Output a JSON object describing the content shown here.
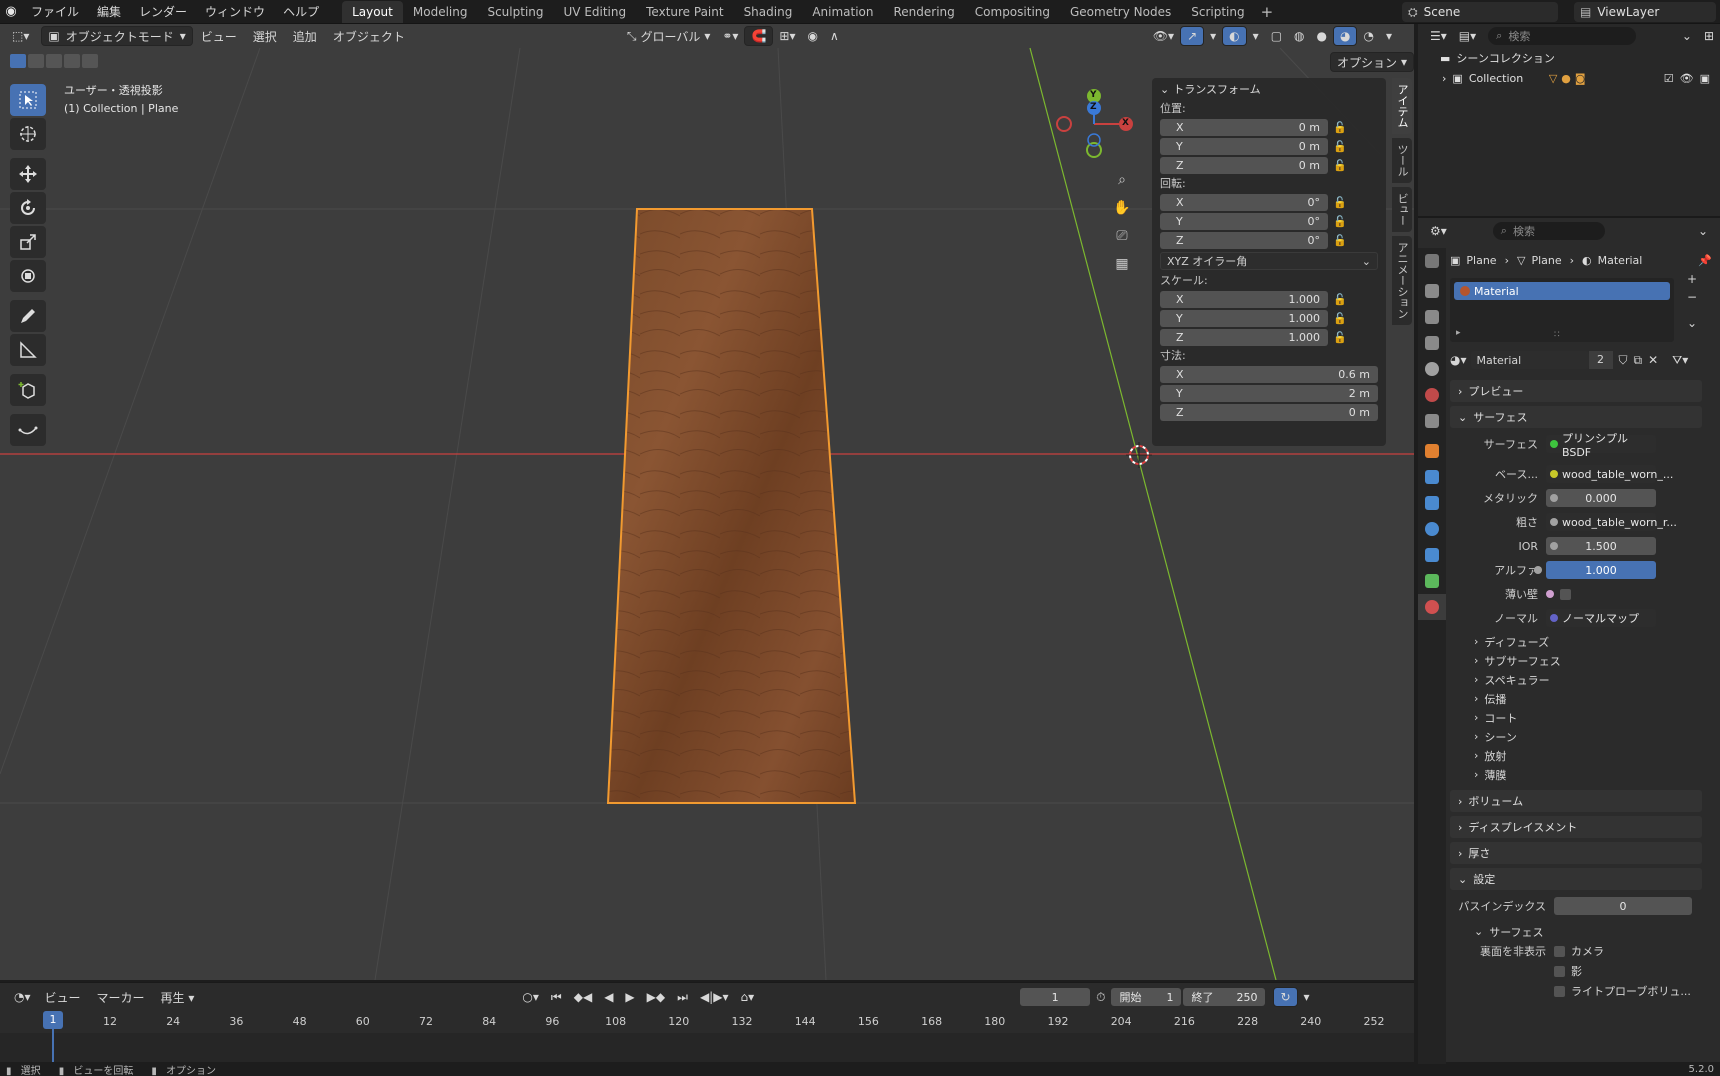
{
  "topbar": {
    "menus": [
      "ファイル",
      "編集",
      "レンダー",
      "ウィンドウ",
      "ヘルプ"
    ],
    "workspaces": [
      {
        "label": "Layout",
        "active": true
      },
      {
        "label": "Modeling"
      },
      {
        "label": "Sculpting"
      },
      {
        "label": "UV Editing"
      },
      {
        "label": "Texture Paint"
      },
      {
        "label": "Shading"
      },
      {
        "label": "Animation"
      },
      {
        "label": "Rendering"
      },
      {
        "label": "Compositing"
      },
      {
        "label": "Geometry Nodes"
      },
      {
        "label": "Scripting"
      }
    ],
    "add_workspace": "+",
    "scene": "Scene",
    "view_layer": "ViewLayer"
  },
  "viewport": {
    "mode": "オブジェクトモード",
    "menus": [
      "ビュー",
      "選択",
      "追加",
      "オブジェクト"
    ],
    "orientation": "グローバル",
    "options": "オプション",
    "info_line1": "ユーザー・透視投影",
    "info_line2": "(1) Collection | Plane",
    "gizmo": {
      "x": "X",
      "y": "Y",
      "z": "Z"
    }
  },
  "npanel": {
    "title": "トランスフォーム",
    "location_label": "位置:",
    "location": [
      {
        "axis": "X",
        "value": "0 m"
      },
      {
        "axis": "Y",
        "value": "0 m"
      },
      {
        "axis": "Z",
        "value": "0 m"
      }
    ],
    "rotation_label": "回転:",
    "rotation": [
      {
        "axis": "X",
        "value": "0°"
      },
      {
        "axis": "Y",
        "value": "0°"
      },
      {
        "axis": "Z",
        "value": "0°"
      }
    ],
    "rotation_mode": "XYZ オイラー角",
    "scale_label": "スケール:",
    "scale": [
      {
        "axis": "X",
        "value": "1.000"
      },
      {
        "axis": "Y",
        "value": "1.000"
      },
      {
        "axis": "Z",
        "value": "1.000"
      }
    ],
    "dimensions_label": "寸法:",
    "dimensions": [
      {
        "axis": "X",
        "value": "0.6 m"
      },
      {
        "axis": "Y",
        "value": "2 m"
      },
      {
        "axis": "Z",
        "value": "0 m"
      }
    ],
    "side_tabs": [
      "アイテム",
      "ツール",
      "ビュー",
      "アニメーション"
    ]
  },
  "timeline": {
    "menus": [
      "ビュー",
      "マーカー",
      "再生"
    ],
    "current_frame": "1",
    "start_label": "開始",
    "start": "1",
    "end_label": "終了",
    "end": "250",
    "ticks": [
      "12",
      "24",
      "36",
      "48",
      "60",
      "72",
      "84",
      "96",
      "108",
      "120",
      "132",
      "144",
      "156",
      "168",
      "180",
      "192",
      "204",
      "216",
      "228",
      "240",
      "252"
    ],
    "marker": "1"
  },
  "status": {
    "items": [
      "選択",
      "ビューを回転",
      "オプション"
    ],
    "version": "5.2.0"
  },
  "outliner": {
    "search_placeholder": "検索",
    "scene_collection": "シーンコレクション",
    "collection": "Collection"
  },
  "properties": {
    "search_placeholder": "検索",
    "breadcrumb": [
      "Plane",
      "Plane",
      "Material"
    ],
    "material_slot": "Material",
    "material_name": "Material",
    "users": "2",
    "panels": {
      "preview": "プレビュー",
      "surface": "サーフェス",
      "volume": "ボリューム",
      "displacement": "ディスプレイスメント",
      "thickness": "厚さ",
      "settings": "設定"
    },
    "surface": {
      "surface_label": "サーフェス",
      "surface_value": "プリンシプルBSDF",
      "base_label": "ベース...",
      "base_value": "wood_table_worn_...",
      "metallic_label": "メタリック",
      "metallic_value": "0.000",
      "roughness_label": "粗さ",
      "roughness_value": "wood_table_worn_r...",
      "ior_label": "IOR",
      "ior_value": "1.500",
      "alpha_label": "アルファ",
      "alpha_value": "1.000",
      "thin_label": "薄い壁",
      "normal_label": "ノーマル",
      "normal_value": "ノーマルマップ"
    },
    "subpanels": [
      "ディフューズ",
      "サブサーフェス",
      "スペキュラー",
      "伝播",
      "コート",
      "シーン",
      "放射",
      "薄膜"
    ],
    "settings": {
      "pass_index_label": "パスインデックス",
      "pass_index": "0",
      "surface_sub": "サーフェス",
      "backface_label": "裏面を非表示",
      "camera": "カメラ",
      "shadow": "影",
      "light_probe": "ライトプローブボリュ..."
    }
  },
  "colors": {
    "accent": "#4772b3",
    "selection_outline": "#f29a30",
    "x_axis": "#c9413f",
    "y_axis": "#7cb82f",
    "z_axis": "#3a79d6"
  }
}
